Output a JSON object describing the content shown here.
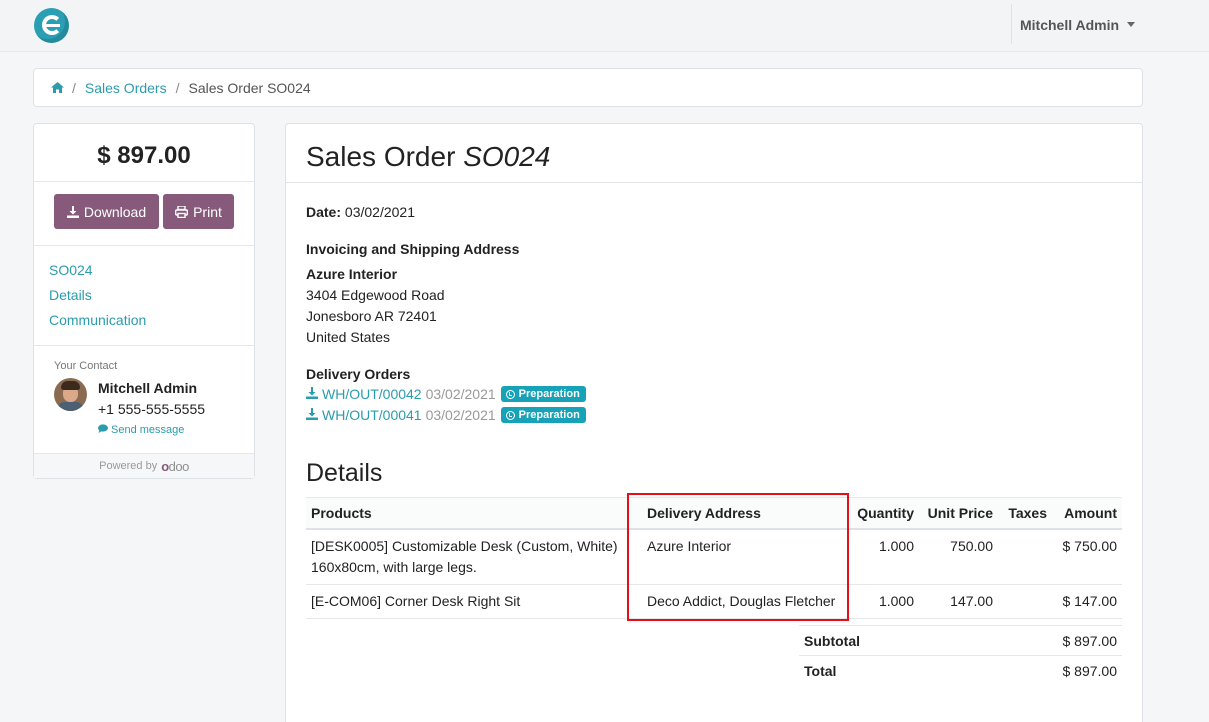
{
  "topbar": {
    "user_name": "Mitchell Admin"
  },
  "breadcrumb": {
    "home_icon": "home-icon",
    "separator": "/",
    "items": [
      "Sales Orders",
      "Sales Order SO024"
    ]
  },
  "sidebar": {
    "amount": "$ 897.00",
    "download_label": "Download",
    "print_label": "Print",
    "nav": [
      "SO024",
      "Details",
      "Communication"
    ],
    "contact_title": "Your Contact",
    "contact_name": "Mitchell Admin",
    "contact_phone": "+1 555-555-5555",
    "send_message": "Send message",
    "powered_by": "Powered by",
    "powered_brand_a": "o",
    "powered_brand_b": "doo"
  },
  "order": {
    "title_prefix": "Sales Order",
    "title_ref": "SO024",
    "date_label": "Date:",
    "date_value": "03/02/2021",
    "address_heading": "Invoicing and Shipping Address",
    "address_name": "Azure Interior",
    "address_lines": [
      "3404 Edgewood Road",
      "Jonesboro AR 72401",
      "United States"
    ],
    "delivery_heading": "Delivery Orders",
    "deliveries": [
      {
        "ref": "WH/OUT/00042",
        "date": "03/02/2021",
        "status": "Preparation"
      },
      {
        "ref": "WH/OUT/00041",
        "date": "03/02/2021",
        "status": "Preparation"
      }
    ],
    "details_heading": "Details",
    "columns": [
      "Products",
      "Delivery Address",
      "Quantity",
      "Unit Price",
      "Taxes",
      "Amount"
    ],
    "lines": [
      {
        "product": "[DESK0005] Customizable Desk (Custom, White) 160x80cm, with large legs.",
        "address": "Azure Interior",
        "quantity": "1.000",
        "unit_price": "750.00",
        "taxes": "",
        "amount": "$ 750.00"
      },
      {
        "product": "[E-COM06] Corner Desk Right Sit",
        "address": "Deco Addict, Douglas Fletcher",
        "quantity": "1.000",
        "unit_price": "147.00",
        "taxes": "",
        "amount": "$ 147.00"
      }
    ],
    "subtotal_label": "Subtotal",
    "subtotal_value": "$ 897.00",
    "total_label": "Total",
    "total_value": "$ 897.00"
  },
  "colors": {
    "accent": "#2a9cad",
    "brand": "#875a7b",
    "badge": "#17a2b8",
    "highlight": "#e3101a"
  }
}
